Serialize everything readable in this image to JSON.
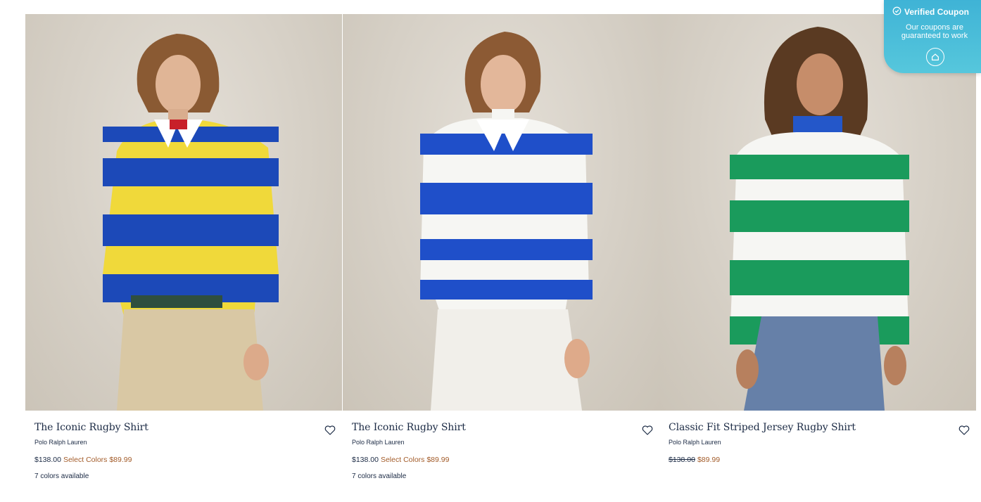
{
  "products": [
    {
      "title": "The Iconic Rugby Shirt",
      "brand": "Polo Ralph Lauren",
      "price": "$138.00",
      "sale_price": "Select Colors $89.99",
      "colors": "7 colors available",
      "stripe_a": "#1c49b8",
      "stripe_b": "#f0d93a",
      "pants": "#d9c8a4"
    },
    {
      "title": "The Iconic Rugby Shirt",
      "brand": "Polo Ralph Lauren",
      "price": "$138.00",
      "sale_price": "Select Colors $89.99",
      "colors": "7 colors available",
      "stripe_a": "#1f4fc9",
      "stripe_b": "#f6f6f3",
      "pants": "#f1efea"
    },
    {
      "title": "Classic Fit Striped Jersey Rugby Shirt",
      "brand": "Polo Ralph Lauren",
      "price": "$138.00",
      "sale_price": "$89.99",
      "colors": "",
      "stripe_a": "#1a9b5c",
      "stripe_b": "#f6f6f3",
      "pants": "#6680a8"
    }
  ],
  "coupon": {
    "title": "Verified Coupon",
    "subtitle_line1": "Our coupons are",
    "subtitle_line2": "guaranteed to work",
    "icon": "home-badge-icon"
  },
  "icons": {
    "favorite": "heart-outline-icon",
    "verified": "check-circle-icon"
  }
}
